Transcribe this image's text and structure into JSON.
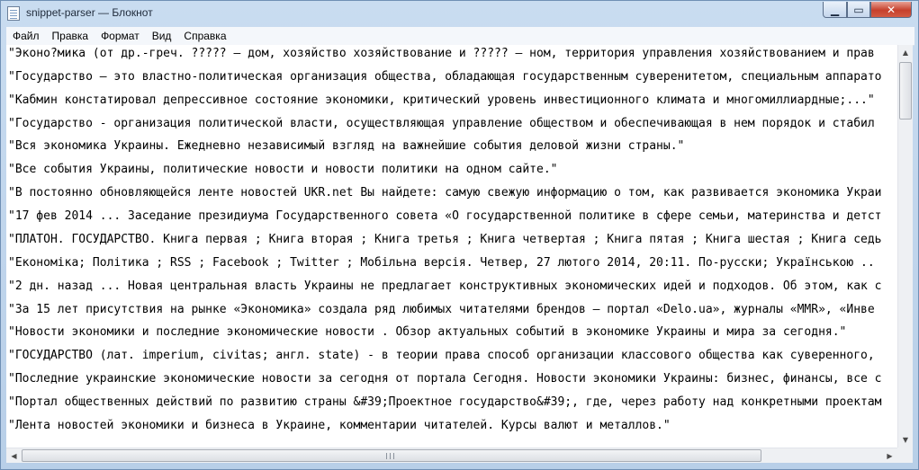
{
  "window": {
    "title": "snippet-parser — Блокнот"
  },
  "controls": {
    "minimize": "▁",
    "maximize": "▭",
    "close": "✕"
  },
  "menu": [
    "Файл",
    "Правка",
    "Формат",
    "Вид",
    "Справка"
  ],
  "lines": [
    "\"Эконо?мика (от др.-греч. ????? — дом, хозяйство хозяйствование и ????? — ном, территория управления хозяйствованием и прав",
    "\"Государство — это властно-политическая организация общества, обладающая государственным суверенитетом, специальным аппарато",
    "\"Кабмин констатировал депрессивное состояние экономики, критический уровень инвестиционного климата и многомиллиардные;...\"",
    "\"Государство - организация политической власти, осуществляющая управление обществом и обеспечивающая в нем порядок и стабил",
    "\"Вся экономика Украины. Ежедневно независимый взгляд на важнейшие события деловой жизни страны.\"",
    "\"Все события Украины, политические новости и новости политики на одном сайте.\"",
    "\"В постоянно обновляющейся ленте новостей UKR.net Вы найдете: самую свежую информацию о том, как развивается экономика Украи",
    "\"17 фев 2014 ... Заседание президиума Государственного совета «О государственной политике в сфере семьи, материнства и детст",
    "\"ПЛАТОН. ГОСУДАРСТВО. Книга первая ; Книга вторая ; Книга третья ; Книга четвертая ; Книга пятая ; Книга шестая ; Книга седь",
    "\"Економіка; Політика ; RSS ; Facebook ; Twitter ; Мобільна версія. Четвер, 27 лютого 2014, 20:11. По-русски; Українською ..",
    "\"2 дн. назад ... Новая центральная власть Украины не предлагает конструктивных экономических идей и подходов. Об этом, как с",
    "\"За 15 лет присутствия на рынке «Экономика» создала ряд любимых читателями брендов — портал «Delo.ua», журналы «MMR», «Инве",
    "\"Новости экономики и последние экономические новости . Обзор актуальных событий в экономике Украины и мира за сегодня.\"",
    "\"ГОСУДАРСТВО (лат. imperium, civitas; англ. state) - в теории права способ организации классового общества как суверенного,",
    "\"Последние украинские экономические новости за сегодня от портала Сегодня. Новости экономики Украины: бизнес, финансы, все с",
    "\"Портал общественных действий по развитию страны &#39;Проектное государство&#39;, где, через работу над конкретными проектам",
    "\"Лента новостей экономики и бизнеса в Украине, комментарии читателей. Курсы валют и металлов.\""
  ],
  "scrollbars": {
    "up": "▲",
    "down": "▼",
    "left": "◀",
    "right": "▶"
  }
}
